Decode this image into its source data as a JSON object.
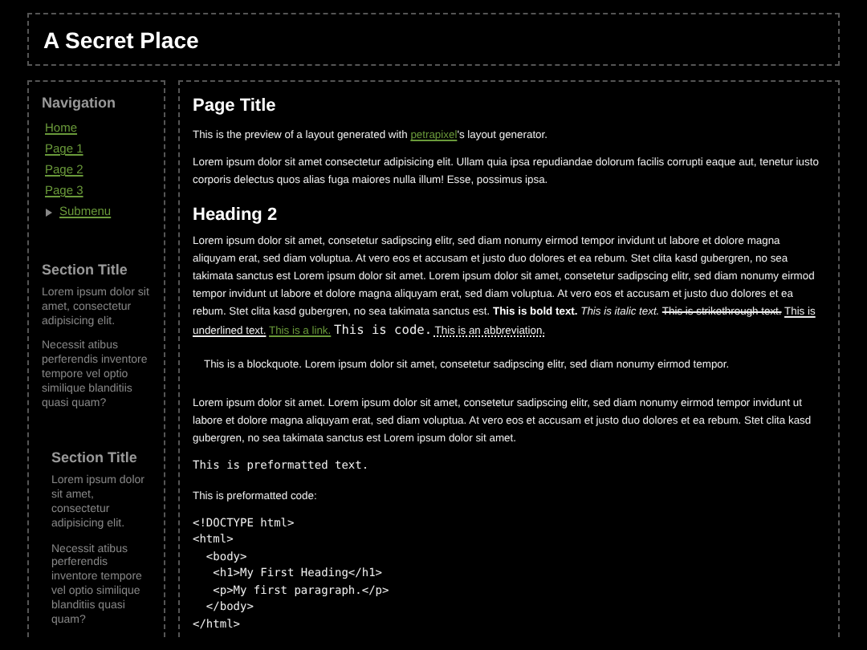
{
  "header": {
    "title": "A Secret Place"
  },
  "sidebar": {
    "navigation": {
      "title": "Navigation",
      "items": [
        {
          "label": "Home",
          "kind": "link"
        },
        {
          "label": "Page 1",
          "kind": "link"
        },
        {
          "label": "Page 2",
          "kind": "link"
        },
        {
          "label": "Page 3",
          "kind": "link"
        },
        {
          "label": "Submenu",
          "kind": "submenu",
          "expanded": false
        }
      ]
    },
    "sections": [
      {
        "title": "Section Title",
        "kind": "plain",
        "paragraphs": [
          "Lorem ipsum dolor sit amet, consectetur adipisicing elit.",
          "Necessit atibus perferendis inventore tempore vel optio similique blanditiis quasi quam?"
        ]
      },
      {
        "title": "Section Title",
        "kind": "indented",
        "paragraphs": [
          "Lorem ipsum dolor sit amet, consectetur adipisicing elit.",
          "Necessit atibus perferendis inventore tempore vel optio similique blanditiis quasi quam?"
        ]
      }
    ]
  },
  "main": {
    "title": "Page Title",
    "intro": [
      {
        "kind": "text",
        "text": "This is the preview of a layout generated with "
      },
      {
        "kind": "link",
        "text": "petrapixel"
      },
      {
        "kind": "text",
        "text": "'s layout generator."
      }
    ],
    "paragraph_1": "Lorem ipsum dolor sit amet consectetur adipisicing elit. Ullam quia ipsa repudiandae dolorum facilis corrupti eaque aut, tenetur iusto corporis delectus quos alias fuga maiores nulla illum! Esse, possimus ipsa.",
    "heading_2": "Heading 2",
    "paragraph_2": [
      {
        "kind": "text",
        "text": "Lorem ipsum dolor sit amet, consetetur sadipscing elitr, sed diam nonumy eirmod tempor invidunt ut labore et dolore magna aliquyam erat, sed diam voluptua. At vero eos et accusam et justo duo dolores et ea rebum. Stet clita kasd gubergren, no sea takimata sanctus est Lorem ipsum dolor sit amet. Lorem ipsum dolor sit amet, consetetur sadipscing elitr, sed diam nonumy eirmod tempor invidunt ut labore et dolore magna aliquyam erat, sed diam voluptua. At vero eos et accusam et justo duo dolores et ea rebum. Stet clita kasd gubergren, no sea takimata sanctus est."
      },
      {
        "kind": "bold",
        "text": "This is bold text."
      },
      {
        "kind": "italic",
        "text": "This is italic text."
      },
      {
        "kind": "strike",
        "text": "This is strikethrough text."
      },
      {
        "kind": "underline",
        "text": "This is underlined text."
      },
      {
        "kind": "link",
        "text": "This is a link."
      },
      {
        "kind": "code",
        "text": "This is code."
      },
      {
        "kind": "abbr",
        "text": "This is an abbreviation."
      }
    ],
    "blockquote": "This is a blockquote. Lorem ipsum dolor sit amet, consetetur sadipscing elitr, sed diam nonumy eirmod tempor.",
    "paragraph_3": "Lorem ipsum dolor sit amet. Lorem ipsum dolor sit amet, consetetur sadipscing elitr, sed diam nonumy eirmod tempor invidunt ut labore et dolore magna aliquyam erat, sed diam voluptua. At vero eos et accusam et justo duo dolores et ea rebum. Stet clita kasd gubergren, no sea takimata sanctus est Lorem ipsum dolor sit amet.",
    "preformatted": "This is preformatted text.",
    "code_caption": "This is preformatted code:",
    "code": "<!DOCTYPE html>\n<html>\n  <body>\n   <h1>My First Heading</h1>\n   <p>My first paragraph.</p>\n  </body>\n</html>"
  }
}
